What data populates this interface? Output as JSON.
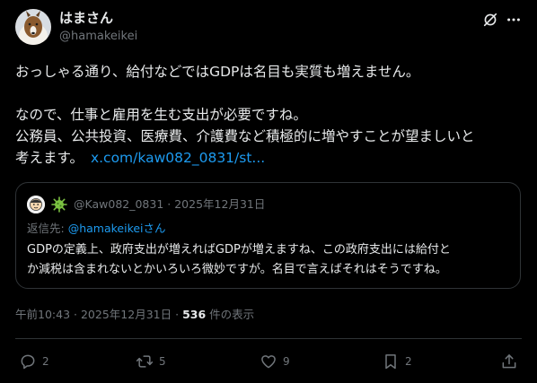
{
  "author": {
    "display_name": "はまさん",
    "handle": "@hamakeikei"
  },
  "post": {
    "lines": [
      "おっしゃる通り、給付などではGDPは名目も実質も増えません。",
      "なので、仕事と雇用を生む支出が必要ですね。",
      "公務員、公共投資、医療費、介護費など積極的に増やすことが望ましいと",
      "考えます。"
    ],
    "link": "x.com/kaw082_0831/st..."
  },
  "quote": {
    "handle": "@Kaw082_0831",
    "date": "2025年12月31日",
    "separator": "·",
    "reply_prefix": "返信先: ",
    "reply_mention": "@hamakeikeiさん",
    "lines": [
      "GDPの定義上、政府支出が増えればGDPが増えますね、この政府支出には給付と",
      "か減税は含まれないとかいろいろ微妙ですが。名目で言えばそれはそうですね。"
    ]
  },
  "meta": {
    "time": "午前10:43",
    "date": "2025年12月31日",
    "separator": "·",
    "views_count": "536",
    "views_label": " 件の表示"
  },
  "actions": {
    "replies": "2",
    "reposts": "5",
    "likes": "9",
    "bookmarks": "2"
  },
  "icons": {
    "header": [
      "grok-icon",
      "more-icon"
    ],
    "actions": [
      "reply-icon",
      "repost-icon",
      "like-icon",
      "bookmark-icon",
      "share-icon"
    ]
  },
  "colors": {
    "background": "#000000",
    "text": "#e7e9ea",
    "muted": "#71767b",
    "link": "#1d9bf0",
    "border": "#2f3336"
  }
}
